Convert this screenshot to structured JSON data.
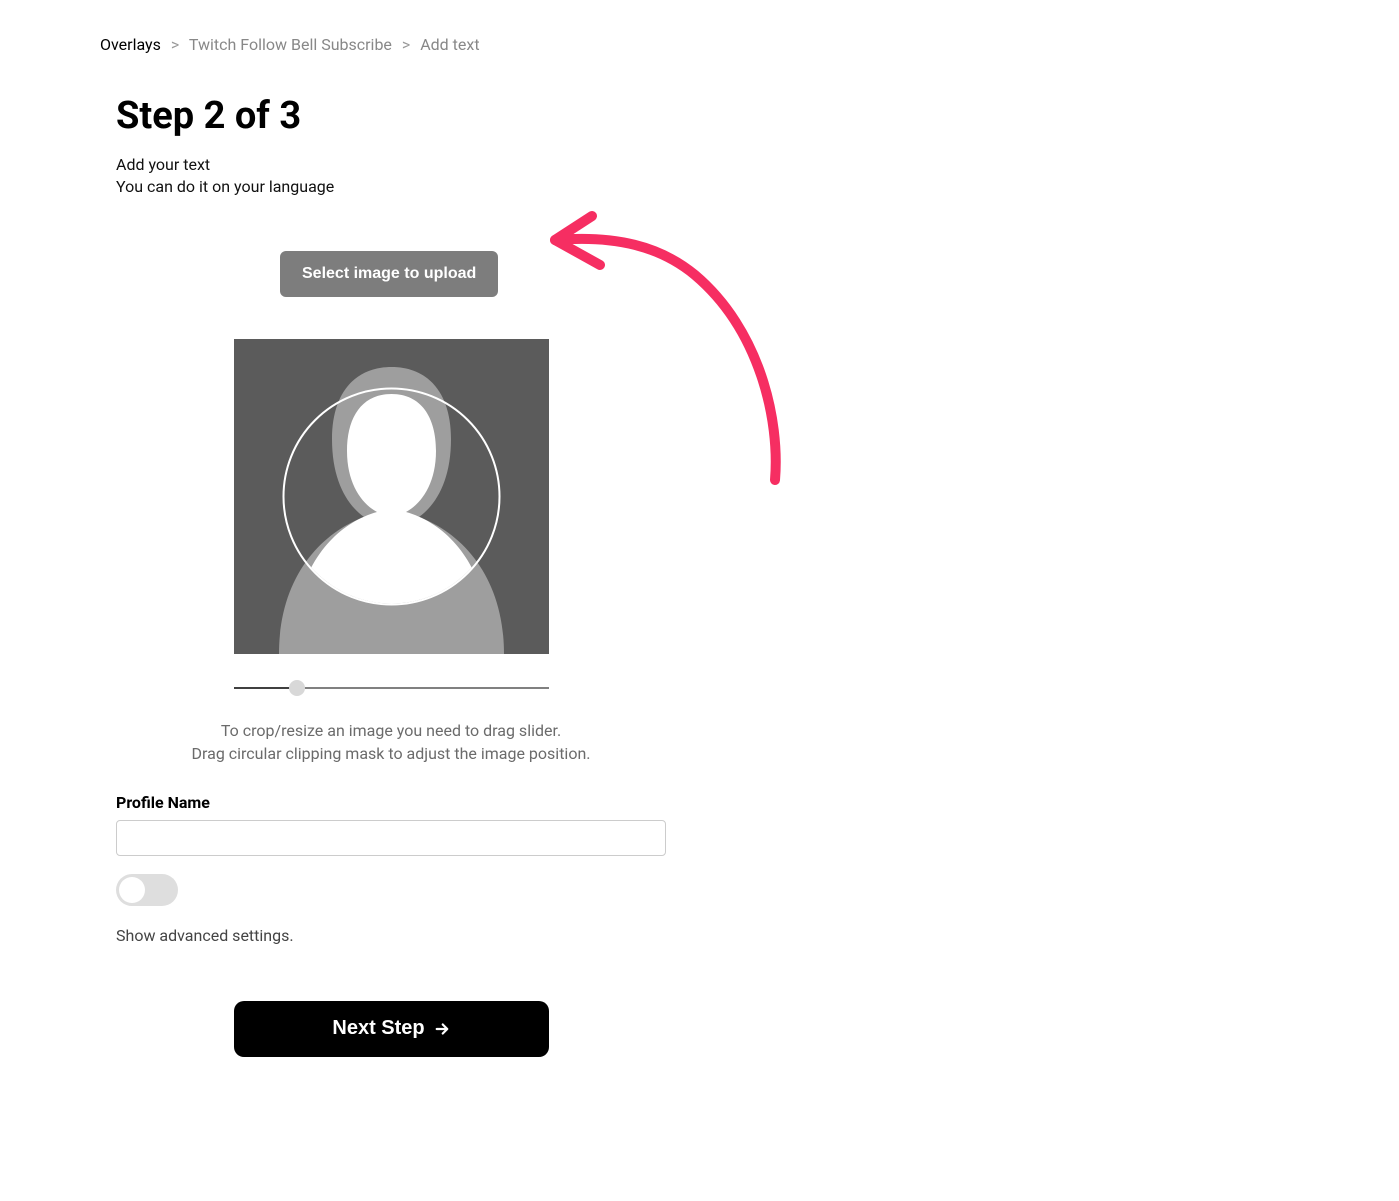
{
  "breadcrumb": {
    "items": [
      {
        "label": "Overlays",
        "active": true
      },
      {
        "label": "Twitch Follow Bell Subscribe",
        "active": false
      },
      {
        "label": "Add text",
        "active": false
      }
    ]
  },
  "step": {
    "title": "Step 2 of 3",
    "desc_line1": "Add your text",
    "desc_line2": "You can do it on your language"
  },
  "upload": {
    "select_button": "Select image to upload",
    "help_line1": "To crop/resize an image you need to drag slider.",
    "help_line2": "Drag circular clipping mask to adjust the image position."
  },
  "form": {
    "profile_name_label": "Profile Name",
    "profile_name_value": "",
    "advanced_toggle_on": false,
    "advanced_label": "Show advanced settings."
  },
  "actions": {
    "next_button": "Next Step"
  },
  "slider": {
    "value_percent": 20
  },
  "colors": {
    "accent_arrow": "#f62e62",
    "placeholder_bg": "#5b5b5b",
    "placeholder_fg": "#9e9e9e"
  }
}
